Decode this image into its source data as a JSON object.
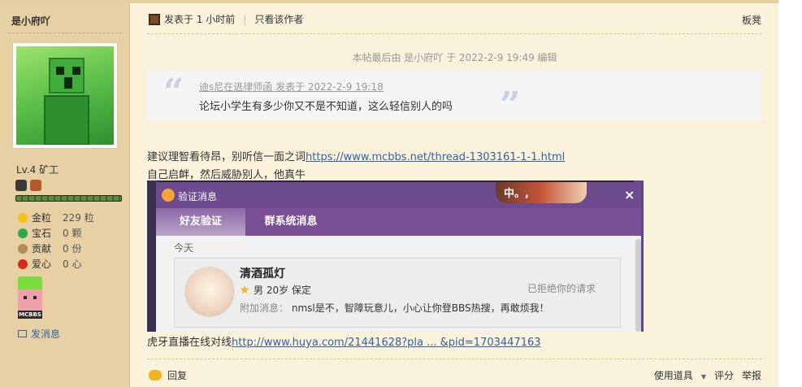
{
  "user": {
    "name": "是小府吖",
    "level": "Lv.4 矿工",
    "stats": [
      {
        "icon": "gold-icon",
        "label": "金粒",
        "value": "229 粒"
      },
      {
        "icon": "gem-icon",
        "label": "宝石",
        "value": "0 颗"
      },
      {
        "icon": "contribution-icon",
        "label": "贡献",
        "value": "0 份"
      },
      {
        "icon": "heart-icon",
        "label": "爱心",
        "value": "0 心"
      }
    ],
    "medal_text": "MCBBS",
    "send_message": "发消息"
  },
  "post": {
    "posted_at": "发表于 1 小时前",
    "only_author": "只看该作者",
    "floor": "板凳",
    "edited_note": "本帖最后由 是小府吖 于 2022-2-9 19:49 编辑",
    "quote": {
      "header": "迪s尼在逃律师函 发表于 2022-2-9 19:18",
      "body": "论坛小学生有多少你又不是不知道，这么轻信别人的吗"
    },
    "line1_text": "建议理智看待昂，别听信一面之词",
    "line1_link": "https://www.mcbbs.net/thread-1303161-1-1.html",
    "line2_text": "自己启衅，然后威胁别人，他真牛",
    "line3_text": "虎牙直播在线对线",
    "line3_link": "http://www.huya.com/21441628?pla ... &pid=1703447163"
  },
  "dialog": {
    "title": "验证消息",
    "close": "×",
    "deco_text": "中。,",
    "tabs": [
      "好友验证",
      "群系统消息"
    ],
    "today": "今天",
    "card": {
      "name": "清酒孤灯",
      "info": "男 20岁 保定",
      "extra_label": "附加消息：",
      "extra_text": "nmsl是不，智障玩意儿，小心让你登BBS热搜，再敢烦我！",
      "status": "已拒绝你的请求"
    }
  },
  "footer": {
    "reply": "回复",
    "tools": "使用道具",
    "rate": "评分",
    "report": "举报"
  }
}
